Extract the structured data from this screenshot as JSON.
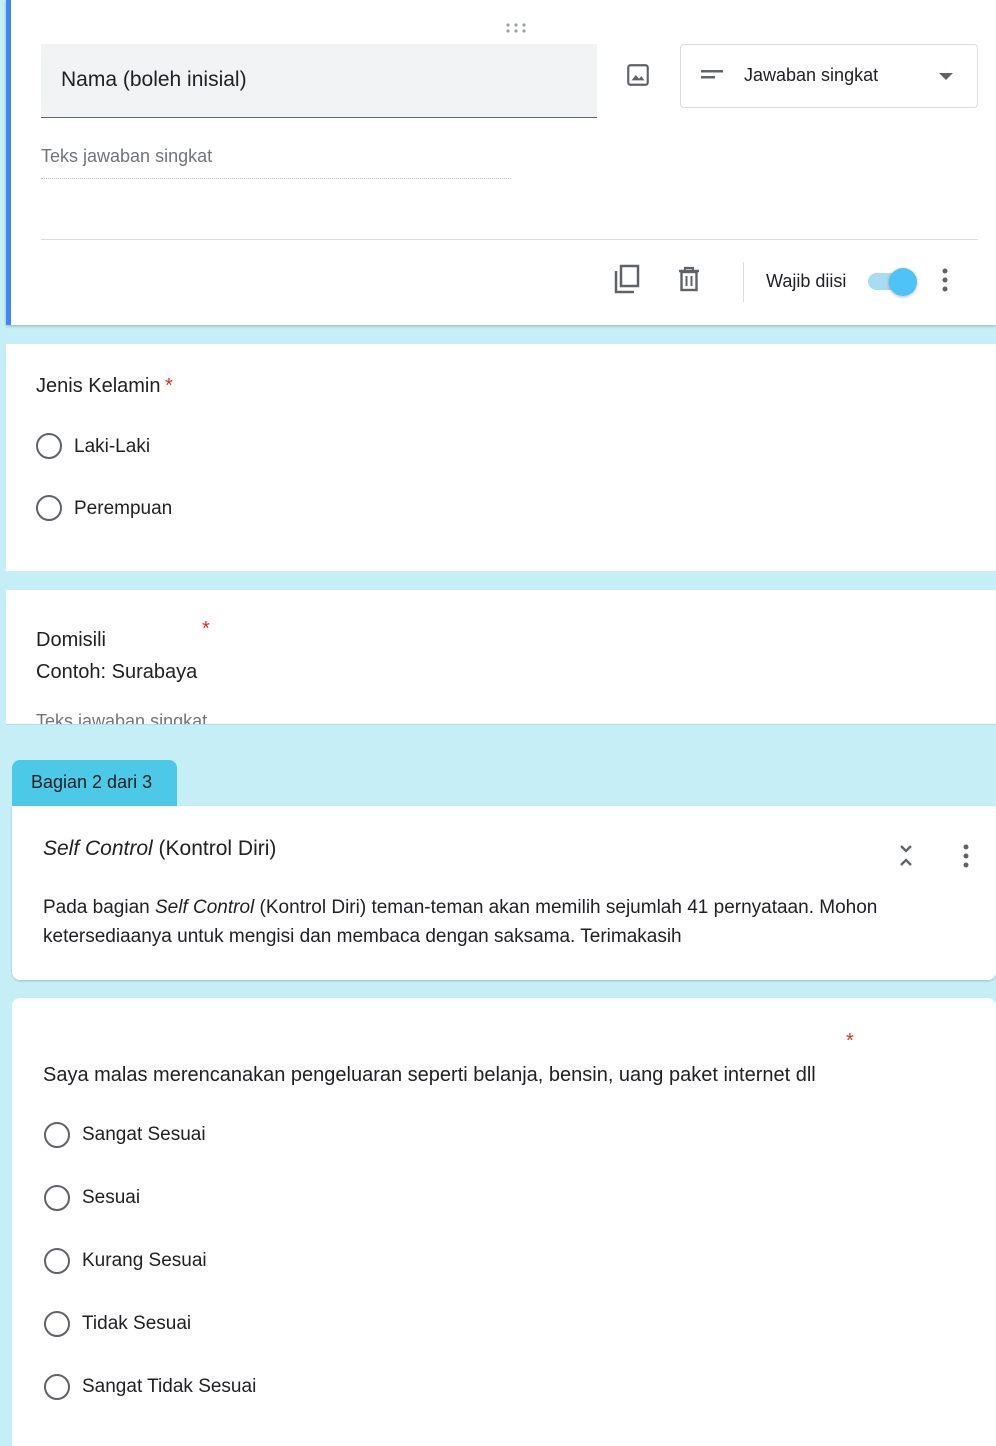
{
  "question_editor": {
    "title": "Nama (boleh inisial)",
    "type_label": "Jawaban singkat",
    "answer_placeholder": "Teks jawaban singkat",
    "required_label": "Wajib diisi",
    "required_on": true
  },
  "question_gender": {
    "title": "Jenis Kelamin",
    "required_mark": "*",
    "options": [
      "Laki-Laki",
      "Perempuan"
    ]
  },
  "question_domicile": {
    "title_line1": "Domisili",
    "title_line2": "Contoh: Surabaya",
    "required_mark": "*",
    "answer_placeholder": "Teks jawaban singkat"
  },
  "section": {
    "tab_label": "Bagian 2 dari 3",
    "title_italic": "Self Control",
    "title_rest": " (Kontrol Diri)",
    "desc_prefix": "Pada bagian ",
    "desc_italic": "Self Control",
    "desc_rest": " (Kontrol Diri) teman-teman akan memilih sejumlah 41 pernyataan. Mohon ketersediaanya untuk mengisi dan membaca dengan saksama. Terimakasih"
  },
  "question_spending": {
    "title": "Saya malas merencanakan pengeluaran seperti belanja, bensin, uang paket internet dll",
    "required_mark": "*",
    "options": [
      "Sangat Sesuai",
      "Sesuai",
      "Kurang Sesuai",
      "Tidak Sesuai",
      "Sangat Tidak Sesuai"
    ]
  },
  "colors": {
    "accent": "#4285f4",
    "toggle": "#4fc3f7",
    "section_tab": "#4dc9e8",
    "background": "#c6eef6",
    "required": "#d93025"
  },
  "icons": [
    "drag-handle-icon",
    "image-icon",
    "short-answer-icon",
    "dropdown-arrow-icon",
    "copy-icon",
    "delete-icon",
    "more-vert-icon",
    "collapse-icon"
  ]
}
